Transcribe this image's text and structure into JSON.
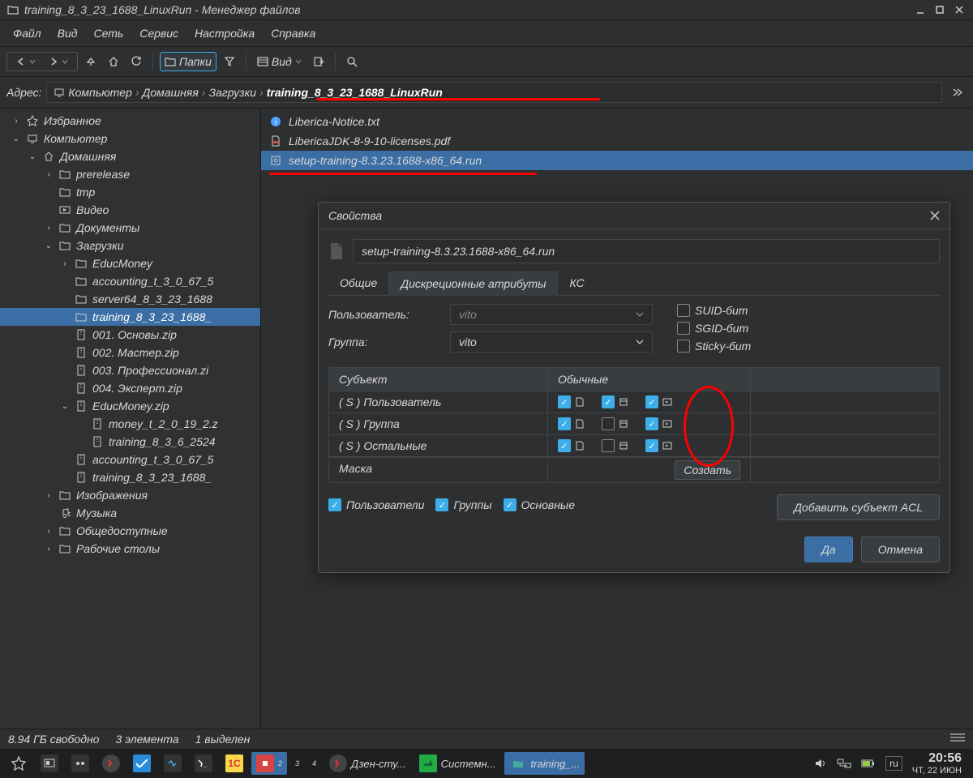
{
  "window_title": "training_8_3_23_1688_LinuxRun - Менеджер файлов",
  "menu": [
    "Файл",
    "Вид",
    "Сеть",
    "Сервис",
    "Настройка",
    "Справка"
  ],
  "toolbar": {
    "folders": "Папки",
    "view": "Вид"
  },
  "address_label": "Адрес:",
  "breadcrumb": [
    "Компьютер",
    "Домашняя",
    "Загрузки",
    "training_8_3_23_1688_LinuxRun"
  ],
  "tree": [
    {
      "l": 0,
      "exp": ">",
      "icon": "star",
      "label": "Избранное"
    },
    {
      "l": 0,
      "exp": "v",
      "icon": "computer",
      "label": "Компьютер"
    },
    {
      "l": 1,
      "exp": "v",
      "icon": "home",
      "label": "Домашняя"
    },
    {
      "l": 2,
      "exp": ">",
      "icon": "folder",
      "label": "prerelease"
    },
    {
      "l": 2,
      "exp": "",
      "icon": "folder",
      "label": "tmp"
    },
    {
      "l": 2,
      "exp": "",
      "icon": "video",
      "label": "Видео"
    },
    {
      "l": 2,
      "exp": ">",
      "icon": "folder",
      "label": "Документы"
    },
    {
      "l": 2,
      "exp": "v",
      "icon": "folder",
      "label": "Загрузки"
    },
    {
      "l": 3,
      "exp": ">",
      "icon": "folder",
      "label": "EducMoney"
    },
    {
      "l": 3,
      "exp": "",
      "icon": "folder",
      "label": "accounting_t_3_0_67_5"
    },
    {
      "l": 3,
      "exp": "",
      "icon": "folder",
      "label": "server64_8_3_23_1688"
    },
    {
      "l": 3,
      "exp": "",
      "icon": "folder",
      "label": "training_8_3_23_1688_",
      "sel": true
    },
    {
      "l": 3,
      "exp": "",
      "icon": "zip",
      "label": "001. Основы.zip"
    },
    {
      "l": 3,
      "exp": "",
      "icon": "zip",
      "label": "002. Мастер.zip"
    },
    {
      "l": 3,
      "exp": "",
      "icon": "zip",
      "label": "003. Профессионал.zi"
    },
    {
      "l": 3,
      "exp": "",
      "icon": "zip",
      "label": "004. Эксперт.zip"
    },
    {
      "l": 3,
      "exp": "v",
      "icon": "zip",
      "label": "EducMoney.zip"
    },
    {
      "l": 4,
      "exp": "",
      "icon": "zip",
      "label": "money_t_2_0_19_2.z"
    },
    {
      "l": 4,
      "exp": "",
      "icon": "zip",
      "label": "training_8_3_6_2524"
    },
    {
      "l": 3,
      "exp": "",
      "icon": "zip",
      "label": "accounting_t_3_0_67_5"
    },
    {
      "l": 3,
      "exp": "",
      "icon": "zip",
      "label": "training_8_3_23_1688_"
    },
    {
      "l": 2,
      "exp": ">",
      "icon": "folder",
      "label": "Изображения"
    },
    {
      "l": 2,
      "exp": "",
      "icon": "music",
      "label": "Музыка"
    },
    {
      "l": 2,
      "exp": ">",
      "icon": "folder",
      "label": "Общедоступные"
    },
    {
      "l": 2,
      "exp": ">",
      "icon": "folder",
      "label": "Рабочие столы"
    }
  ],
  "files": [
    {
      "icon": "info",
      "label": "Liberica-Notice.txt"
    },
    {
      "icon": "pdf",
      "label": "LibericaJDK-8-9-10-licenses.pdf"
    },
    {
      "icon": "run",
      "label": "setup-training-8.3.23.1688-x86_64.run",
      "sel": true,
      "red": true
    }
  ],
  "dialog": {
    "title": "Свойства",
    "filename": "setup-training-8.3.23.1688-x86_64.run",
    "tabs": [
      "Общие",
      "Дискреционные атрибуты",
      "КС"
    ],
    "user_label": "Пользователь:",
    "user_value": "vito",
    "group_label": "Группа:",
    "group_value": "vito",
    "suid": "SUID-бит",
    "sgid": "SGID-бит",
    "sticky": "Sticky-бит",
    "col_subject": "Субъект",
    "col_perms": "Обычные",
    "rows": [
      {
        "name": "( S )  Пользователь",
        "r": true,
        "w": true,
        "x": true
      },
      {
        "name": "( S )  Группа",
        "r": true,
        "w": false,
        "x": true
      },
      {
        "name": "( S )  Остальные",
        "r": true,
        "w": false,
        "x": true
      }
    ],
    "mask": "Маска",
    "create_btn": "Создать",
    "filter_users": "Пользователи",
    "filter_groups": "Группы",
    "filter_main": "Основные",
    "add_acl": "Добавить субъект ACL",
    "ok": "Да",
    "cancel": "Отмена"
  },
  "status": {
    "free": "8.94 ГБ свободно",
    "count": "3 элемента",
    "selected": "1 выделен"
  },
  "taskbar": {
    "items": [
      "Дзен-сту...",
      "Системн...",
      "training_..."
    ],
    "lang": "ru",
    "time": "20:56",
    "date": "ЧТ, 22 ИЮН"
  }
}
